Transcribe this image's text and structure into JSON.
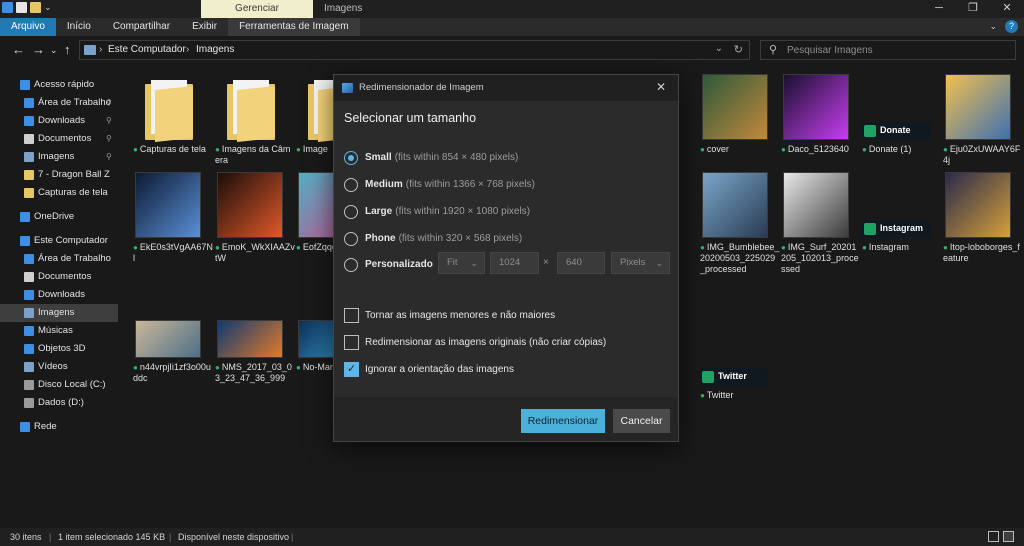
{
  "titlebar": {
    "manage_label": "Gerenciar",
    "window_title": "Imagens",
    "min_glyph": "─",
    "max_glyph": "❐",
    "close_glyph": "✕"
  },
  "ribbon": {
    "tabs": [
      "Arquivo",
      "Início",
      "Compartilhar",
      "Exibir",
      "Ferramentas de Imagem"
    ],
    "expand_glyph": "⌄",
    "help_glyph": "?"
  },
  "address": {
    "back_glyph": "←",
    "forward_glyph": "→",
    "recent_glyph": "⌄",
    "up_glyph": "↑",
    "crumbs": [
      "Este Computador",
      "Imagens"
    ],
    "separator": "›",
    "dropdown_glyph": "⌄",
    "refresh_glyph": "↻"
  },
  "search": {
    "placeholder": "Pesquisar Imagens",
    "icon_glyph": "⚲"
  },
  "sidebar": {
    "items": [
      {
        "label": "Acesso rápido",
        "icon": "star-icon",
        "color": "#3d8ee6",
        "indent": 0,
        "pinned": false
      },
      {
        "label": "Área de Trabalho",
        "icon": "desktop-icon",
        "color": "#3d8ee6",
        "indent": 1,
        "pinned": true
      },
      {
        "label": "Downloads",
        "icon": "download-icon",
        "color": "#3d8ee6",
        "indent": 1,
        "pinned": true
      },
      {
        "label": "Documentos",
        "icon": "documents-icon",
        "color": "#cfcfcf",
        "indent": 1,
        "pinned": true
      },
      {
        "label": "Imagens",
        "icon": "pictures-icon",
        "color": "#7ba2c9",
        "indent": 1,
        "pinned": true
      },
      {
        "label": "7 - Dragon Ball Z",
        "icon": "folder-icon",
        "color": "#e7c665",
        "indent": 1,
        "pinned": false
      },
      {
        "label": "Capturas de tela",
        "icon": "folder-icon",
        "color": "#e7c665",
        "indent": 1,
        "pinned": false
      },
      {
        "label": "OneDrive",
        "icon": "cloud-icon",
        "color": "#3d8ee6",
        "indent": 0,
        "pinned": false,
        "gap": true
      },
      {
        "label": "Este Computador",
        "icon": "computer-icon",
        "color": "#3d8ee6",
        "indent": 0,
        "pinned": false,
        "gap": true
      },
      {
        "label": "Área de Trabalho",
        "icon": "desktop-icon",
        "color": "#3d8ee6",
        "indent": 1,
        "pinned": false
      },
      {
        "label": "Documentos",
        "icon": "documents-icon",
        "color": "#cfcfcf",
        "indent": 1,
        "pinned": false
      },
      {
        "label": "Downloads",
        "icon": "download-icon",
        "color": "#3d8ee6",
        "indent": 1,
        "pinned": false
      },
      {
        "label": "Imagens",
        "icon": "pictures-icon",
        "color": "#7ba2c9",
        "indent": 1,
        "pinned": false,
        "selected": true
      },
      {
        "label": "Músicas",
        "icon": "music-icon",
        "color": "#3d8ee6",
        "indent": 1,
        "pinned": false
      },
      {
        "label": "Objetos 3D",
        "icon": "cube-icon",
        "color": "#3d8ee6",
        "indent": 1,
        "pinned": false
      },
      {
        "label": "Vídeos",
        "icon": "video-icon",
        "color": "#7ba2c9",
        "indent": 1,
        "pinned": false
      },
      {
        "label": "Disco Local (C:)",
        "icon": "drive-icon",
        "color": "#9a9a9a",
        "indent": 1,
        "pinned": false
      },
      {
        "label": "Dados (D:)",
        "icon": "drive-icon",
        "color": "#9a9a9a",
        "indent": 1,
        "pinned": false
      },
      {
        "label": "Rede",
        "icon": "network-icon",
        "color": "#3d8ee6",
        "indent": 0,
        "pinned": false,
        "gap": true
      }
    ],
    "pin_glyph": "📌"
  },
  "files": [
    {
      "name": "Capturas de tela",
      "kind": "folder",
      "col": 0,
      "row": 0
    },
    {
      "name": "Imagens da Câmera",
      "kind": "folder",
      "col": 1,
      "row": 0
    },
    {
      "name": "Image",
      "kind": "folder",
      "col": 2,
      "row": 0
    },
    {
      "name": "cover",
      "kind": "image",
      "col": 7,
      "row": 0,
      "colors": [
        "#2e5a3a",
        "#c2883d"
      ]
    },
    {
      "name": "Daco_5123640",
      "kind": "image",
      "col": 8,
      "row": 0,
      "colors": [
        "#1a1030",
        "#c73ef0"
      ]
    },
    {
      "name": "Donate (1)",
      "kind": "badge",
      "col": 9,
      "row": 0,
      "badge": "Donate",
      "colors": [
        "#101820",
        "#1fa463"
      ]
    },
    {
      "name": "Eju0ZxUWAAY6F4j",
      "kind": "image",
      "col": 10,
      "row": 0,
      "colors": [
        "#f2c14e",
        "#3e6fb0"
      ]
    },
    {
      "name": "EkE0s3tVgAA67Nl",
      "kind": "image",
      "col": 0,
      "row": 1,
      "colors": [
        "#0b1a33",
        "#5b8fd6"
      ]
    },
    {
      "name": "EmoK_WkXIAAZvtW",
      "kind": "image",
      "col": 1,
      "row": 1,
      "colors": [
        "#1a0e08",
        "#e0582a"
      ]
    },
    {
      "name": "EofZqqeE-",
      "kind": "image",
      "col": 2,
      "row": 1,
      "colors": [
        "#4fb0c6",
        "#c94f8a"
      ]
    },
    {
      "name": "IMG_Bumblebee_20200503_225029_processed",
      "kind": "image",
      "col": 7,
      "row": 1,
      "colors": [
        "#7aa6c8",
        "#2a3b52"
      ]
    },
    {
      "name": "IMG_Surf_20201205_102013_processed",
      "kind": "image",
      "col": 8,
      "row": 1,
      "colors": [
        "#e8e8e8",
        "#3b3b3b"
      ]
    },
    {
      "name": "Instagram",
      "kind": "badge",
      "col": 9,
      "row": 1,
      "badge": "Instagram",
      "colors": [
        "#101820",
        "#1fa463"
      ]
    },
    {
      "name": "Itop-loboborges_feature",
      "kind": "image",
      "col": 10,
      "row": 1,
      "colors": [
        "#2a2a4a",
        "#d6a03a"
      ]
    },
    {
      "name": "n44vrpjIi1zf3o00uddc",
      "kind": "image",
      "col": 0,
      "row": 2,
      "colors": [
        "#c9b79a",
        "#4d6f88"
      ]
    },
    {
      "name": "NMS_2017_03_03_23_47_36_999",
      "kind": "image",
      "col": 1,
      "row": 2,
      "colors": [
        "#0f3a70",
        "#e27a2a"
      ]
    },
    {
      "name": "No-Mans-reboot",
      "kind": "image",
      "col": 2,
      "row": 2,
      "colors": [
        "#0c2f55",
        "#3aa3d8"
      ]
    },
    {
      "name": "Twitter",
      "kind": "badge",
      "col": 7,
      "row": 2,
      "badge": "Twitter",
      "colors": [
        "#101820",
        "#1fa463"
      ]
    }
  ],
  "dialog": {
    "title": "Redimensionador de Imagem",
    "close_glyph": "✕",
    "heading": "Selecionar um tamanho",
    "options": [
      {
        "label": "Small",
        "hint": "(fits within 854 × 480 pixels)",
        "selected": true
      },
      {
        "label": "Medium",
        "hint": "(fits within 1366 × 768 pixels)",
        "selected": false
      },
      {
        "label": "Large",
        "hint": "(fits within 1920 × 1080 pixels)",
        "selected": false
      },
      {
        "label": "Phone",
        "hint": "(fits within 320 × 568 pixels)",
        "selected": false
      },
      {
        "label": "Personalizado",
        "hint": "",
        "selected": false
      }
    ],
    "custom": {
      "fit_value": "Fit",
      "width": "1024",
      "times": "×",
      "height": "640",
      "unit": "Pixels",
      "caret": "⌄"
    },
    "checks": [
      {
        "label": "Tornar as imagens menores e não maiores",
        "checked": false
      },
      {
        "label": "Redimensionar as imagens originais (não criar cópias)",
        "checked": false
      },
      {
        "label": "Ignorar a orientação das imagens",
        "checked": true
      }
    ],
    "resize_button": "Redimensionar",
    "cancel_button": "Cancelar",
    "accent": "#4cb1d8"
  },
  "statusbar": {
    "items": [
      "30 itens",
      "1 item selecionado  145 KB",
      "Disponível neste dispositivo"
    ],
    "separator": "|"
  }
}
